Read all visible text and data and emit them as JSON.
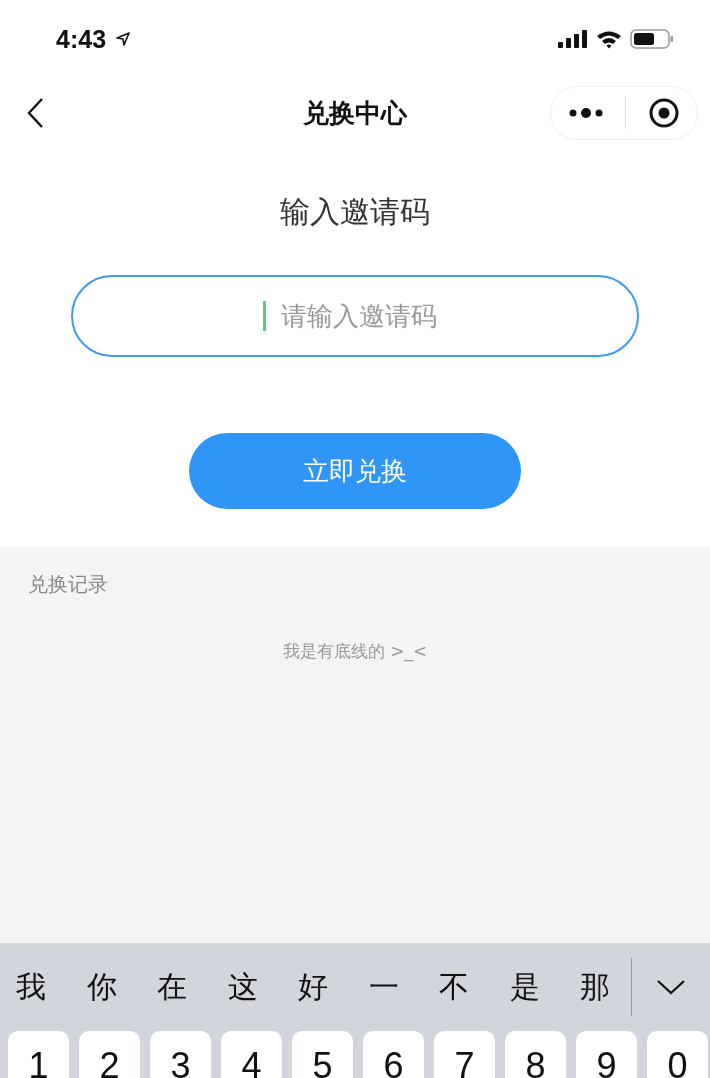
{
  "status_bar": {
    "time": "4:43"
  },
  "nav": {
    "title": "兑换中心"
  },
  "heading": "输入邀请码",
  "code_field": {
    "placeholder": "请输入邀请码",
    "focused": true
  },
  "redeem_button": "立即兑换",
  "history": {
    "title": "兑换记录",
    "end_note": "我是有底线的 >_<"
  },
  "keyboard": {
    "candidates": [
      "我",
      "你",
      "在",
      "这",
      "好",
      "一",
      "不",
      "是",
      "那"
    ],
    "keys": [
      "1",
      "2",
      "3",
      "4",
      "5",
      "6",
      "7",
      "8",
      "9",
      "0"
    ]
  }
}
